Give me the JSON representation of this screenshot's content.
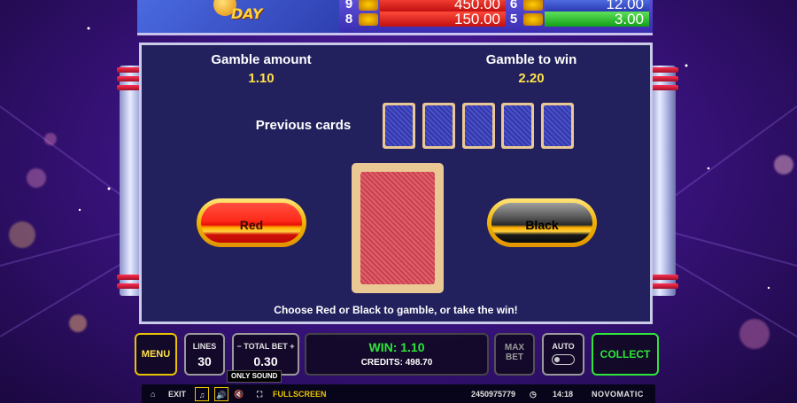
{
  "paytable": {
    "logo_text": "DAY",
    "rows": [
      {
        "left_num": "9",
        "left_value": "450.00",
        "right_num": "6",
        "right_value": "12.00"
      },
      {
        "left_num": "8",
        "left_value": "150.00",
        "right_num": "5",
        "right_value": "3.00"
      }
    ]
  },
  "gamble": {
    "amount_label": "Gamble amount",
    "amount_value": "1.10",
    "to_win_label": "Gamble to win",
    "to_win_value": "2.20",
    "previous_cards_label": "Previous cards",
    "previous_cards_count": 5,
    "red_label": "Red",
    "black_label": "Black",
    "hint": "Choose Red or Black to gamble, or take the win!"
  },
  "controls": {
    "menu": "MENU",
    "lines_label": "LINES",
    "lines_value": "30",
    "total_bet_label": "TOTAL BET",
    "total_bet_value": "0.30",
    "win_text": "WIN: 1.10",
    "credits_text": "CREDITS: 498.70",
    "max_bet_line1": "MAX",
    "max_bet_line2": "BET",
    "auto_label": "AUTO",
    "collect": "COLLECT"
  },
  "status_bar": {
    "exit": "EXIT",
    "tooltip": "ONLY SOUND",
    "fullscreen": "FULLSCREEN",
    "session_id": "2450975779",
    "time": "14:18",
    "brand": "NOVOMATIC"
  },
  "colors": {
    "win_green": "#2ee63a",
    "gold_value": "#ffe24a",
    "panel_bg": "#22215e"
  }
}
